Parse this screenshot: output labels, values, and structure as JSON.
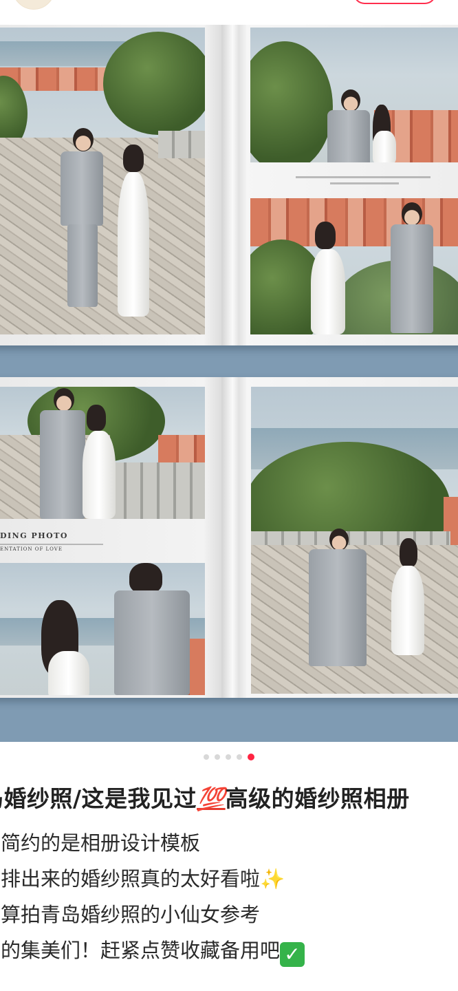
{
  "post": {
    "title_prefix": "岛婚纱照/这是我见过",
    "title_emoji": "💯",
    "title_suffix": "高级的婚纱照相册",
    "lines": [
      {
        "text": "级简约的是相册设计模板",
        "emoji": ""
      },
      {
        "text": "祥排出来的婚纱照真的太好看啦",
        "emoji": "✨"
      },
      {
        "text": "打算拍青岛婚纱照的小仙女参考",
        "emoji": ""
      },
      {
        "text": "昏的集美们！赶紧点赞收藏备用吧",
        "emoji": "✓"
      }
    ]
  },
  "album": {
    "caption_title": "DING PHOTO",
    "caption_sub": "ENTATION OF LOVE"
  },
  "carousel": {
    "total": 5,
    "active_index": 5
  },
  "colors": {
    "accent": "#ff2442",
    "backdrop": "#7f9bb3",
    "check_green": "#35b34a"
  }
}
